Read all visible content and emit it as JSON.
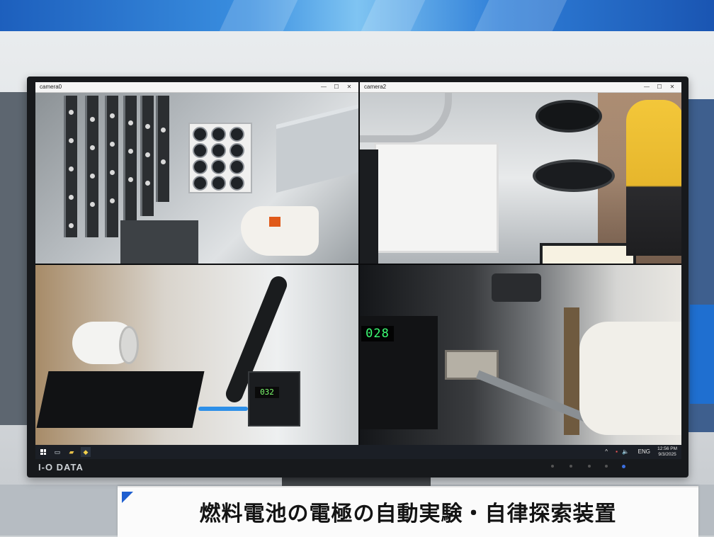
{
  "windows": [
    {
      "title": "camera0",
      "controls": {
        "minimize": "—",
        "maximize": "☐",
        "close": "✕"
      }
    },
    {
      "title": "camera2",
      "controls": {
        "minimize": "—",
        "maximize": "☐",
        "close": "✕"
      }
    }
  ],
  "readouts": {
    "camera3_counter": "032",
    "camera4_counter": "028"
  },
  "taskbar": {
    "start_icon": "windows-logo-icon",
    "pinned": [
      "task-view-icon",
      "file-explorer-icon",
      "python-app-icon"
    ],
    "tray": {
      "chevron": "^",
      "language": "ENG",
      "time": "12:56 PM",
      "date": "9/3/2025"
    }
  },
  "monitor": {
    "brand": "I-O DATA"
  },
  "caption": {
    "text": "燃料電池の電極の自動実験・自律探索装置"
  },
  "colors": {
    "accent_blue": "#1f5fd0",
    "counter_green": "#3cff74",
    "taskbar": "#1b1f26"
  }
}
